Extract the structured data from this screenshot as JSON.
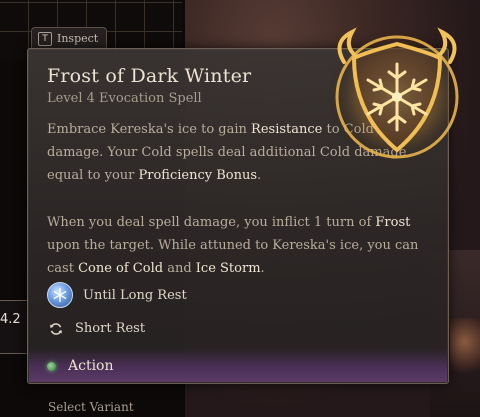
{
  "inspect": {
    "key": "T",
    "label": "Inspect"
  },
  "spell": {
    "title": "Frost of Dark Winter",
    "subtitle": "Level 4 Evocation Spell",
    "desc1": {
      "a": "Embrace Kereska's ice to gain ",
      "b": "Resistance",
      "c": " to Cold damage. Your Cold spells deal additional Cold damage equal to your ",
      "d": "Proficiency Bonus",
      "e": "."
    },
    "desc2": {
      "a": "When you deal spell damage, you inflict 1 turn of ",
      "b": "Frost",
      "c": " upon the target. While attuned to Kereska's ice, you can cast ",
      "d": "Cone of Cold",
      "e": " and ",
      "f": "Ice Storm",
      "g": "."
    },
    "duration": "Until Long Rest",
    "recharge": "Short Rest",
    "cost": "Action"
  },
  "background": {
    "counter": "4.2",
    "footer": "Select Variant"
  },
  "colors": {
    "emblem_gold": "#e8b24a",
    "action_purple": "#5b3a68",
    "highlight_text": "#efe5d2"
  },
  "icons": {
    "emblem": "snowflake-emblem-icon",
    "duration": "frost-icon",
    "recharge": "refresh-icon",
    "cost": "action-dot-icon"
  }
}
